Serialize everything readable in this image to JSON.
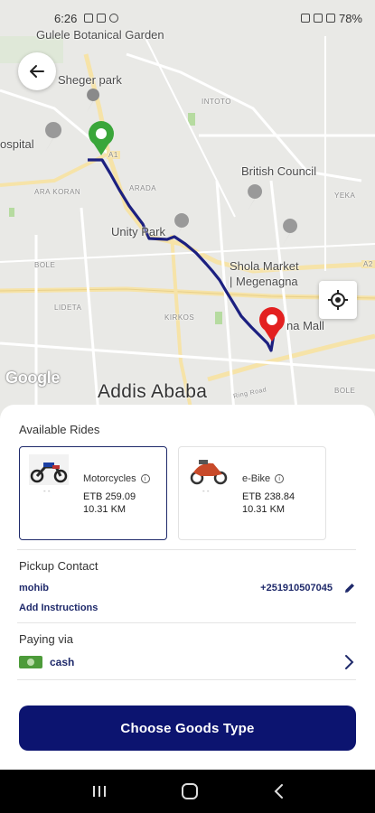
{
  "status_bar": {
    "time": "6:26",
    "battery": "78%"
  },
  "map": {
    "labels": {
      "garden": "Gulele Botanical Garden",
      "sheger_park": "Sheger park",
      "hospital": "ospital",
      "british_council": "British Council",
      "unity_park": "Unity Park",
      "shola_market": "Shola Market",
      "megenagna": "| Megenagna",
      "mall": "na Mall",
      "city": "Addis Ababa",
      "ara_koran": "ARA KORAN",
      "arada": "ARADA",
      "intoto": "INTOTO",
      "yeka": "YEKA",
      "bole_w": "BOLE",
      "lideta": "LIDETA",
      "kirkos": "KIRKOS",
      "bole_e": "BOLE",
      "a1": "A1",
      "a2": "A2",
      "ring_road": "Ring Road"
    },
    "google_logo": "Google"
  },
  "available_rides": {
    "title": "Available Rides",
    "options": [
      {
        "name": "Motorcycles",
        "price": "ETB 259.09",
        "distance": "10.31 KM",
        "selected": true,
        "icon": "motorcycle-icon"
      },
      {
        "name": "e-Bike",
        "price": "ETB 238.84",
        "distance": "10.31 KM",
        "selected": false,
        "icon": "scooter-icon"
      }
    ]
  },
  "pickup_contact": {
    "title": "Pickup Contact",
    "name": "mohib",
    "phone": "+251910507045",
    "add_instructions": "Add Instructions"
  },
  "payment": {
    "title": "Paying via",
    "method": "cash"
  },
  "cta_label": "Choose Goods Type",
  "colors": {
    "primary": "#0c1470",
    "route": "#1c2080",
    "pickup_pin": "#3aa63a",
    "drop_pin": "#e32020"
  }
}
